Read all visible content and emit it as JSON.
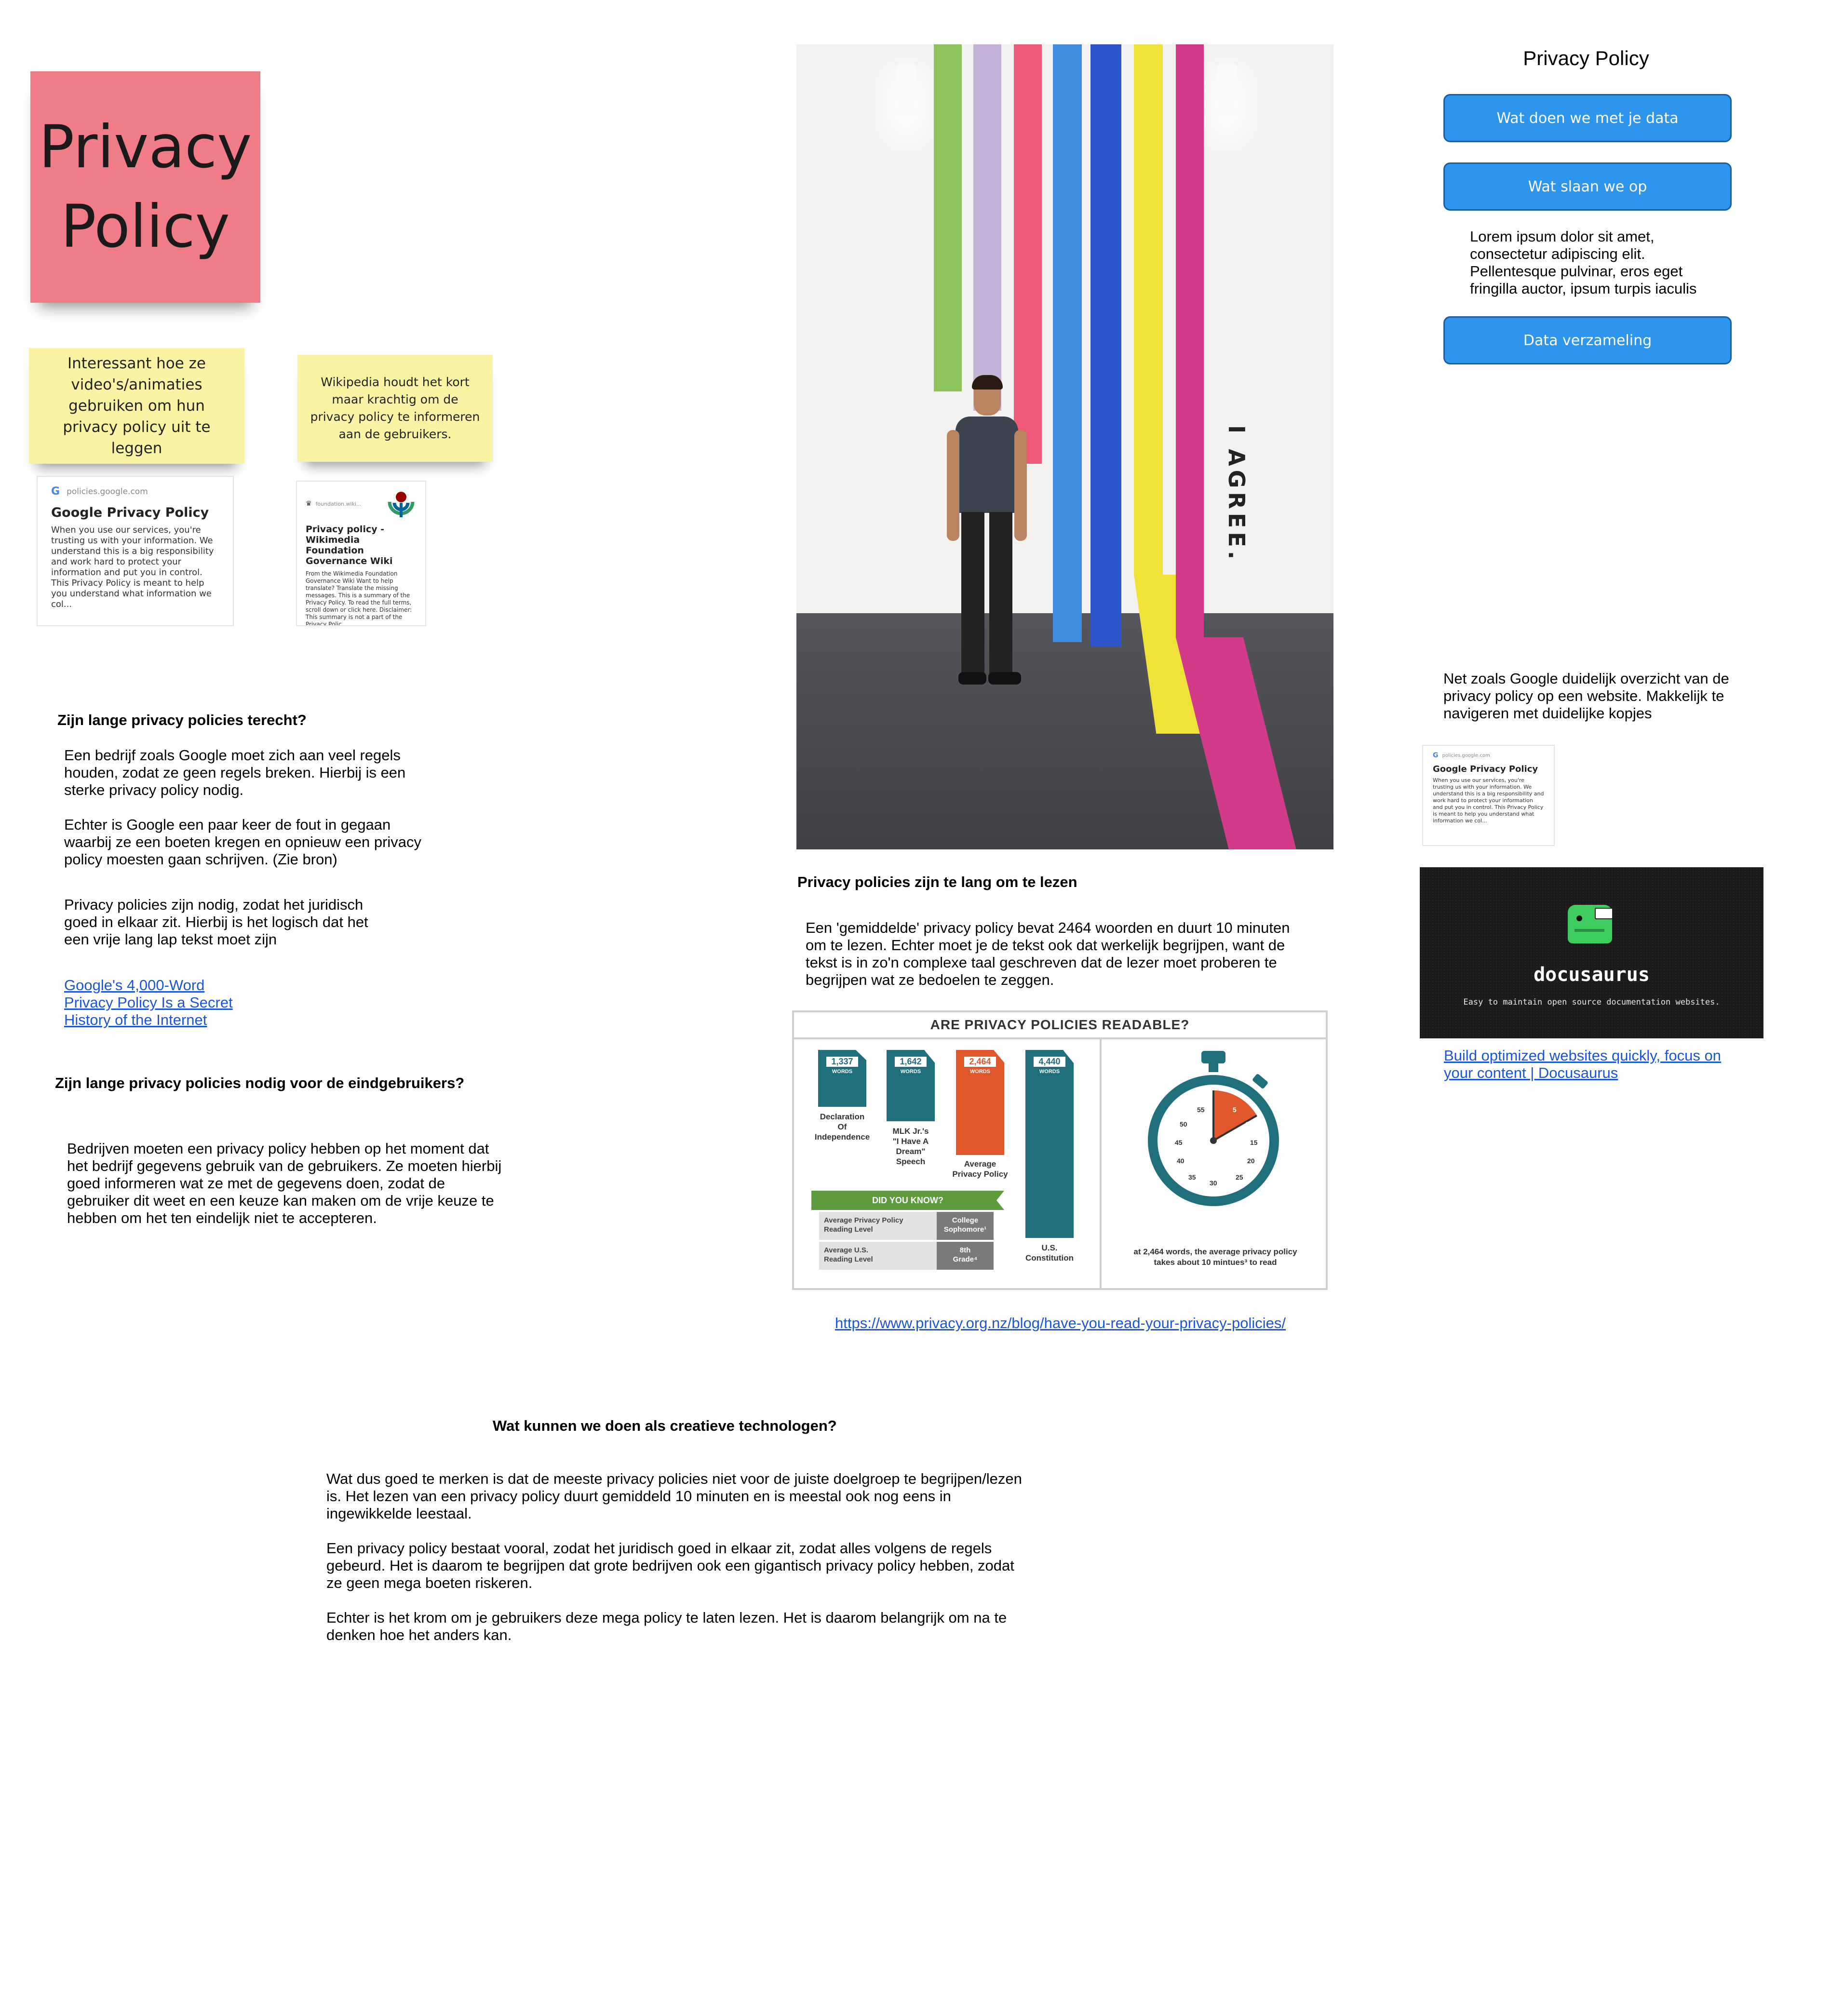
{
  "board": {
    "title_note": "Privacy\nPolicy",
    "note_animations": "Interessant hoe ze video's/animaties gebruiken om hun privacy policy uit te leggen",
    "note_wikipedia": "Wikipedia houdt het kort maar krachtig om de privacy policy te informeren aan de gebruikers."
  },
  "google_card": {
    "source": "policies.google.com",
    "title": "Google Privacy Policy",
    "text": "When you use our services, you're trusting us with your information. We understand this is a big responsibility and work hard to protect your information and put you in control. This Privacy Policy is meant to help you understand what information we col..."
  },
  "wiki_card": {
    "source": "foundation.wiki...",
    "title": "Privacy policy - Wikimedia Foundation Governance Wiki",
    "text": "From the Wikimedia Foundation Governance Wiki Want to help translate? Translate the missing messages. This is a summary of the Privacy Policy. To read the full terms, scroll down or click here. Disclaimer: This summary is not a part of the Privacy Polic..."
  },
  "section_long": {
    "heading": "Zijn lange privacy policies terecht?",
    "p1": "Een bedrijf zoals Google moet zich aan veel regels\nhouden, zodat ze geen regels breken. Hierbij is een\nsterke privacy policy nodig.\n\nEchter is Google een paar keer de fout in gegaan\nwaarbij ze een boeten kregen en opnieuw een privacy\npolicy moesten gaan schrijven. (Zie bron)",
    "p2": "Privacy policies zijn nodig, zodat het juridisch\ngoed in elkaar zit. Hierbij is het logisch dat het\neen vrije lang lap tekst moet zijn",
    "links": [
      "Google's 4,000-Word",
      "Privacy Policy Is a Secret",
      "History of the Internet"
    ]
  },
  "section_needed": {
    "heading": "Zijn lange privacy policies nodig voor de eindgebruikers?",
    "p": "Bedrijven moeten een privacy policy hebben op het moment dat\nhet bedrijf gegevens gebruik van de gebruikers. Ze moeten hierbij\ngoed informeren wat ze met de gegevens doen, zodat de\ngebruiker dit weet en een keuze kan maken om de vrije keuze te\nhebben om het ten eindelijk niet te accepteren."
  },
  "photo": {
    "sign": "I AGREE."
  },
  "section_too_long": {
    "heading": "Privacy policies zijn te lang om te lezen",
    "p": "Een 'gemiddelde' privacy policy bevat 2464 woorden en duurt 10 minuten\nom te lezen. Echter moet je de tekst ook dat werkelijk begrijpen, want de\ntekst is in zo'n complexe taal geschreven dat de lezer moet proberen te\nbegrijpen wat ze bedoelen te zeggen.",
    "link": "https://www.privacy.org.nz/blog/have-you-read-your-privacy-policies/"
  },
  "infographic": {
    "title": "ARE PRIVACY POLICIES READABLE?",
    "words_label": "WORDS",
    "docs": [
      {
        "count": "1,337",
        "label": "Declaration\nOf\nIndependence",
        "color": "#1f6f7d"
      },
      {
        "count": "1,642",
        "label": "MLK Jr.'s\n\"I Have A\nDream\"\nSpeech",
        "color": "#1f6f7d"
      },
      {
        "count": "2,464",
        "label": "Average\nPrivacy Policy",
        "color": "#e0572b"
      },
      {
        "count": "4,440",
        "label": "U.S.\nConstitution",
        "color": "#1f6f7d"
      }
    ],
    "did_you_know": "DID YOU KNOW?",
    "levels": [
      {
        "label": "Average Privacy Policy\nReading Level",
        "value": "College\nSophomore¹"
      },
      {
        "label": "Average U.S.\nReading Level",
        "value": "8th\nGrade⁴"
      }
    ],
    "stopwatch_numbers": [
      "55",
      "5",
      "10",
      "15",
      "20",
      "25",
      "30",
      "35",
      "40",
      "45",
      "50"
    ],
    "caption": "at 2,464 words, the average privacy policy\ntakes about 10 mintues³ to read"
  },
  "section_creative": {
    "heading": "Wat kunnen we doen als creatieve technologen?",
    "p": "Wat dus goed te merken is dat de meeste privacy policies niet voor de juiste doelgroep te begrijpen/lezen\nis. Het lezen van een privacy policy duurt gemiddeld 10 minuten en is meestal ook nog eens in\ningewikkelde leestaal.\n\nEen privacy policy bestaat vooral, zodat het juridisch goed in elkaar zit, zodat alles volgens de regels\ngebeurd. Het is daarom te begrijpen dat grote bedrijven ook een gigantisch privacy policy hebben, zodat\nze geen mega boeten riskeren.\n\nEchter is het krom om je gebruikers deze mega policy te laten lezen. Het is daarom belangrijk om na te\ndenken hoe het anders kan."
  },
  "mockup": {
    "title": "Privacy Policy",
    "btn1": "Wat doen we met je data",
    "btn2": "Wat slaan we op",
    "lorem": "Lorem ipsum dolor sit amet,\nconsectetur adipiscing elit.\nPellentesque pulvinar, eros eget\nfringilla auctor, ipsum turpis iaculis",
    "btn3": "Data verzameling"
  },
  "section_google_note": {
    "p": "Net zoals Google duidelijk overzicht van de\nprivacy policy op een website. Makkelijk te\nnavigeren met duidelijke kopjes"
  },
  "docusaurus": {
    "name": "docusaurus",
    "tagline": "Easy to maintain open source documentation websites.",
    "link": "Build optimized websites quickly, focus on\nyour content | Docusaurus"
  }
}
